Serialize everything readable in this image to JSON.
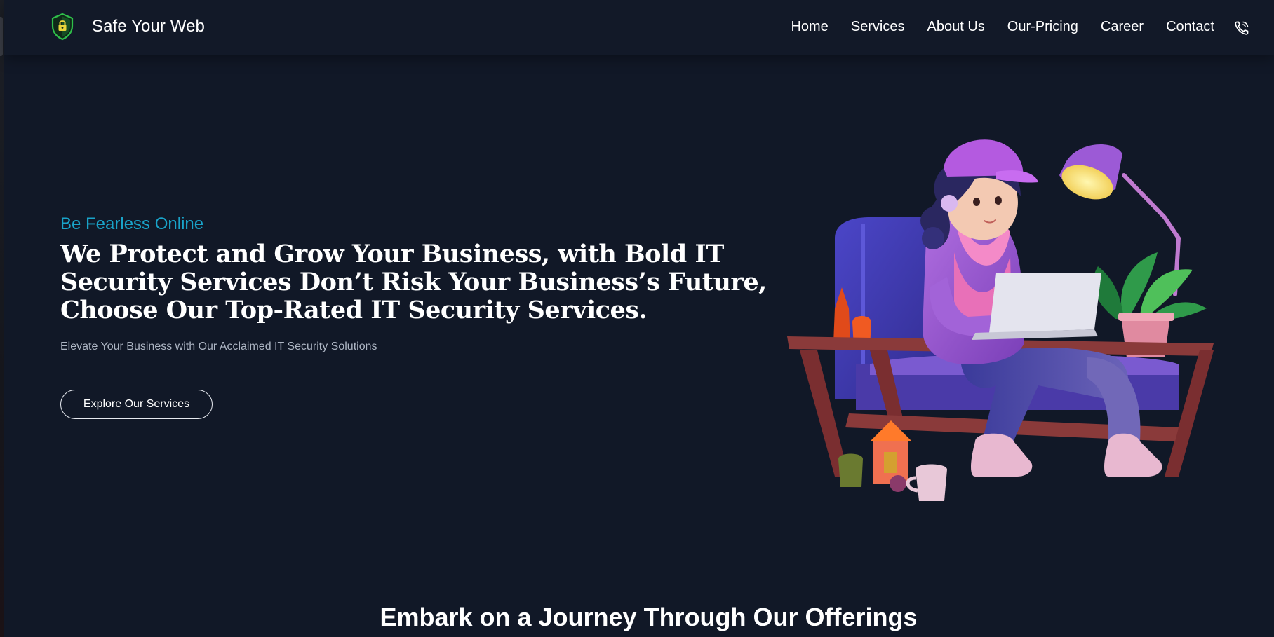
{
  "header": {
    "brand_name": "Safe Your Web",
    "nav": [
      {
        "label": "Home"
      },
      {
        "label": "Services"
      },
      {
        "label": "About Us"
      },
      {
        "label": "Our-Pricing"
      },
      {
        "label": "Career"
      },
      {
        "label": "Contact"
      }
    ],
    "phone_icon": "phone-call-icon",
    "logo_icon": "shield-lock-icon"
  },
  "hero": {
    "tagline": "Be Fearless Online",
    "title": "We Protect and Grow Your Business, with Bold IT Security Services Don’t Risk Your Business’s Future, Choose Our Top-Rated IT Security Services.",
    "subtitle": "Elevate Your Business with Our Acclaimed IT Security Solutions",
    "cta_label": "Explore Our Services",
    "illustration": "girl-with-laptop-illustration"
  },
  "offerings": {
    "title": "Embark on a Journey Through Our Offerings"
  },
  "colors": {
    "background": "#111827",
    "navbar": "#121928",
    "accent": "#19a3c9",
    "logo_green": "#2fbf4a"
  }
}
